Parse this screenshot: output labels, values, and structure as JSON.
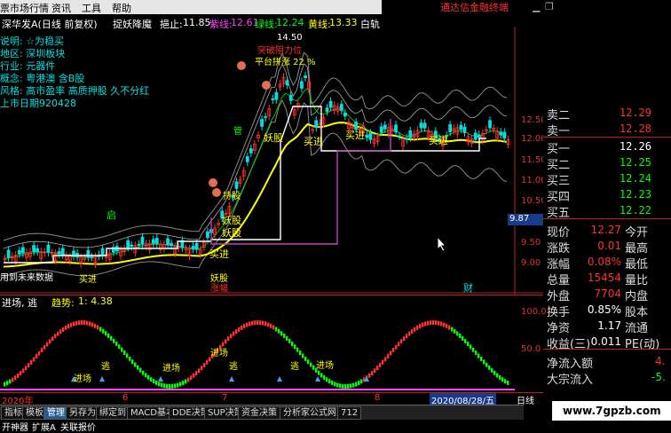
{
  "menu": {
    "items": [
      "票市场行情",
      "资讯",
      "工具",
      "帮助"
    ],
    "notice": "通达信金融终端"
  },
  "title": {
    "stock": "深华发A(日线 前复权)",
    "indicator": "捉妖降魔",
    "stop_label": "挹止:",
    "stop_value": "11.85",
    "purple_label": "紫线:",
    "purple_value": "12.61",
    "green_label": "绿线:",
    "green_value": "12.24",
    "yellow_label": "黄线:",
    "yellow_value": "13.33",
    "white_label": "白轨"
  },
  "info": {
    "desc": "说明: ☆为稳买",
    "region": "地区: 深圳板块",
    "industry": "行业: 元器件",
    "concept": "概念: 粤港澳 含B股",
    "style": "风格: 高市盈率 高质押股 久不分红",
    "listing": "上市日期920428"
  },
  "chart_labels": {
    "high_price": "14.50",
    "surge": "平台拼涨 22 %",
    "surge_top": "突破阻力位",
    "demon1": "妖股",
    "demon2": "妖股",
    "demon3": "妖股",
    "demon4": "妖股",
    "buy1": "买进",
    "buy2": "买进",
    "buy3": "买进",
    "buy4": "买进",
    "buy5": "买进",
    "start_day": "启",
    "hold": "持股",
    "future_data": "用到未来数据",
    "fin": "财",
    "yel_small": "管",
    "low_label": "涨幅"
  },
  "yaxis": [
    "12.50",
    "12.00",
    "11.50",
    "11.00",
    "10.50",
    "10.00",
    "9.50",
    "9.00"
  ],
  "price_marker": "9.87",
  "quote": {
    "asks": [
      {
        "label": "卖二",
        "value": "12.29"
      },
      {
        "label": "卖一",
        "value": "12.28"
      }
    ],
    "bids": [
      {
        "label": "买一",
        "value": "12.26"
      },
      {
        "label": "买二",
        "value": "12.25"
      },
      {
        "label": "买三",
        "value": "12.24"
      },
      {
        "label": "买四",
        "value": "12.23"
      },
      {
        "label": "买五",
        "value": "12.22"
      }
    ],
    "stats": [
      {
        "label": "现价",
        "value": "12.27",
        "extra": "今开"
      },
      {
        "label": "涨跌",
        "value": "0.01",
        "extra": "最高"
      },
      {
        "label": "涨幅",
        "value": "0.08%",
        "extra": "最低"
      },
      {
        "label": "总量",
        "value": "15454",
        "extra": "量比"
      },
      {
        "label": "外盘",
        "value": "7704",
        "extra": "内盘"
      },
      {
        "label": "换手",
        "value": "0.85%",
        "extra": "股本"
      },
      {
        "label": "净资",
        "value": "1.17",
        "extra": "流通"
      },
      {
        "label": "收益(三)",
        "value": "0.011",
        "extra": "PE(动)"
      }
    ],
    "flow": [
      {
        "label": "净流入额",
        "value": "4."
      },
      {
        "label": "大宗流入",
        "value": "-5."
      }
    ]
  },
  "sub": {
    "name": "进场, 逃",
    "trend_label": "趋势:",
    "trend_value": "1: 4.38",
    "axis_top": "100.0",
    "axis_mid": "50.0",
    "tags": [
      "进场",
      "进场",
      "逃",
      "进场",
      "逃",
      "进场",
      "逃"
    ]
  },
  "dates": [
    "2020年",
    "6",
    "7",
    "8",
    "2020/08/28/五"
  ],
  "toolbar": [
    "指标",
    "模板",
    "管理",
    "另存为",
    "绑定到",
    "MACD基本",
    "DDE决策",
    "SUP决策",
    "资金决策",
    "分析家公式网",
    "712"
  ],
  "bottom": [
    "开神器",
    "扩展A",
    "关联报价"
  ],
  "right_tag": "日线",
  "watermark": "www.7gpzb.com",
  "colors": {
    "up": "#ff3030",
    "down": "#00e0e0",
    "yellow": "#ffff00",
    "green": "#00ff00",
    "purple": "#c040c0",
    "white": "#ffffff"
  }
}
